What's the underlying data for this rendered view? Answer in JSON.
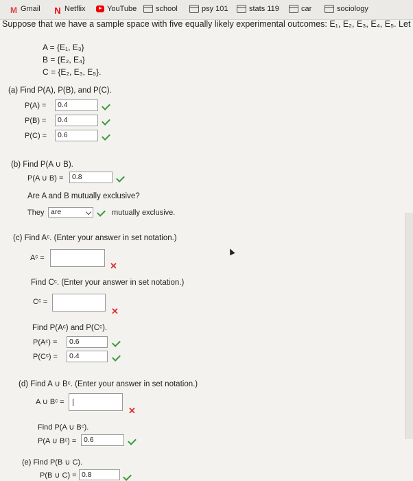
{
  "bookmarks": [
    {
      "label": "Gmail"
    },
    {
      "label": "Netflix"
    },
    {
      "label": "YouTube"
    },
    {
      "label": "school"
    },
    {
      "label": "psy 101"
    },
    {
      "label": "stats 119"
    },
    {
      "label": "car"
    },
    {
      "label": "sociology"
    }
  ],
  "problem": {
    "intro": "Suppose that we have a sample space with five equally likely experimental outcomes: E₁, E₂, E₃, E₄, E₅. Let",
    "set_a": "A = {E₁, E₃}",
    "set_b": "B = {E₂, E₄}",
    "set_c": "C = {E₂, E₃, E₅}."
  },
  "part_a": {
    "heading": "(a)  Find P(A), P(B), and P(C).",
    "pa_label": "P(A)  =",
    "pa_value": "0.4",
    "pb_label": "P(B)  =",
    "pb_value": "0.4",
    "pc_label": "P(C)  =",
    "pc_value": "0.6"
  },
  "part_b": {
    "heading": "(b)  Find P(A ∪ B).",
    "pab_label": "P(A ∪ B)  =",
    "pab_value": "0.8",
    "question": "Are A and B mutually exclusive?",
    "they": "They",
    "select_value": "are",
    "suffix": "mutually exclusive."
  },
  "part_c": {
    "heading": "(c)  Find Aᶜ. (Enter your answer in set notation.)",
    "ac_label": "Aᶜ =",
    "ac_value": "",
    "find_cc": "Find Cᶜ. (Enter your answer in set notation.)",
    "cc_label": "Cᶜ =",
    "cc_value": "",
    "find_probs": "Find P(Aᶜ) and P(Cᶜ).",
    "pac_label": "P(Aᶜ)  =",
    "pac_value": "0.6",
    "pcc_label": "P(Cᶜ)  =",
    "pcc_value": "0.4"
  },
  "part_d": {
    "heading": "(d)  Find A ∪ Bᶜ. (Enter your answer in set notation.)",
    "aubc_label": "A ∪ Bᶜ =",
    "aubc_value": "",
    "find_prob": "Find P(A ∪ Bᶜ).",
    "paubc_label": "P(A ∪ Bᶜ)  =",
    "paubc_value": "0.6"
  },
  "part_e": {
    "heading": "(e)  Find P(B ∪ C).",
    "pbuc_label": "P(B ∪ C)  =",
    "pbuc_value": "0.8"
  },
  "colors": {
    "correct": "#3a9a3a",
    "incorrect": "#d33"
  }
}
